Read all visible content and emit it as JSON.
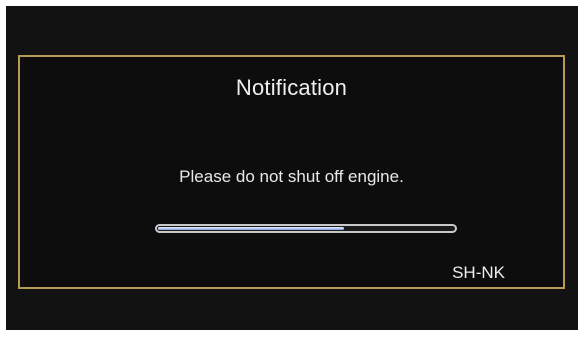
{
  "dialog": {
    "title": "Notification",
    "message": "Please do not shut off engine.",
    "progress": 0.63,
    "code": "SH-NK"
  },
  "colors": {
    "screen_background": "#121212",
    "dialog_border": "#b49c55",
    "text": "#f0f0f0",
    "progress_fill": "#aec6ee",
    "progress_border": "#c8c8c8"
  }
}
